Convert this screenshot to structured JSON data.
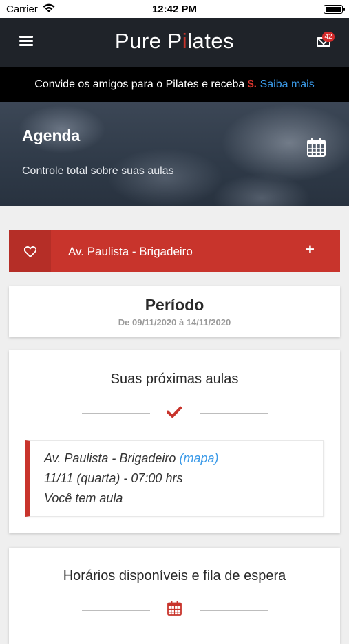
{
  "status_bar": {
    "carrier": "Carrier",
    "time": "12:42 PM"
  },
  "navbar": {
    "logo_text_before": "Pure P",
    "logo_text_bar": "i",
    "logo_text_after": "lates",
    "mail_badge": "42"
  },
  "promo": {
    "text": "Convide os amigos para o Pilates e receba ",
    "dollar": "$.",
    "link": "Saiba mais"
  },
  "hero": {
    "title": "Agenda",
    "subtitle": "Controle total sobre suas aulas"
  },
  "studio": {
    "name": "Av. Paulista - Brigadeiro",
    "add_label": "+"
  },
  "period": {
    "heading": "Período",
    "range": "De 09/11/2020 à 14/11/2020"
  },
  "next_classes": {
    "heading": "Suas próximas aulas",
    "lesson": {
      "location": "Av. Paulista - Brigadeiro",
      "map_link": "(mapa)",
      "datetime": "11/11 (quarta) - 07:00 hrs",
      "status": "Você tem aula"
    }
  },
  "available": {
    "heading": "Horários disponíveis e fila de espera"
  },
  "colors": {
    "accent": "#c8342c",
    "link": "#3b9ae8",
    "nav_bg": "#1f2329"
  }
}
